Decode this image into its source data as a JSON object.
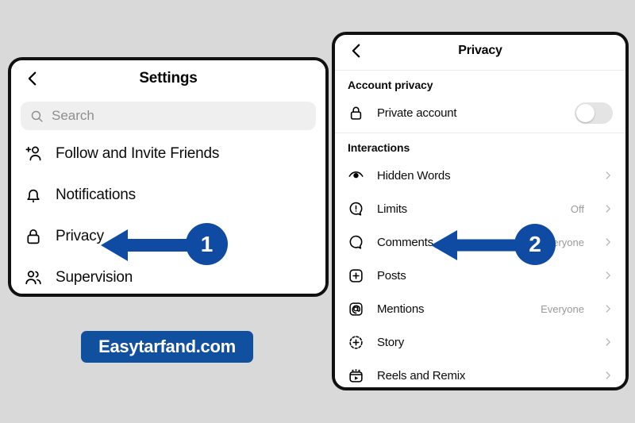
{
  "background_color": "#d9d9d9",
  "accent_color": "#0f4ba3",
  "watermark": {
    "text": "Easytarfand.com",
    "background": "#11509f",
    "text_color": "#ffffff"
  },
  "settings_panel": {
    "header": {
      "title": "Settings",
      "back_icon": "chevron-left-icon"
    },
    "search": {
      "placeholder": "Search",
      "value": "",
      "icon": "search-icon"
    },
    "items": [
      {
        "label": "Follow and Invite Friends",
        "icon": "add-person-icon"
      },
      {
        "label": "Notifications",
        "icon": "bell-icon"
      },
      {
        "label": "Privacy",
        "icon": "lock-icon"
      },
      {
        "label": "Supervision",
        "icon": "people-icon"
      }
    ]
  },
  "privacy_panel": {
    "header": {
      "title": "Privacy",
      "back_icon": "chevron-left-icon"
    },
    "sections": [
      {
        "title": "Account privacy",
        "items": [
          {
            "label": "Private account",
            "icon": "lock-icon",
            "control": "toggle",
            "toggle_on": false,
            "value": "",
            "chevron": false
          }
        ]
      },
      {
        "title": "Interactions",
        "items": [
          {
            "label": "Hidden Words",
            "icon": "eye-icon",
            "control": "chevron",
            "value": "",
            "chevron": true
          },
          {
            "label": "Limits",
            "icon": "exclamation-bubble-icon",
            "control": "chevron",
            "value": "Off",
            "chevron": true
          },
          {
            "label": "Comments",
            "icon": "comment-bubble-icon",
            "control": "chevron",
            "value": "Everyone",
            "chevron": true
          },
          {
            "label": "Posts",
            "icon": "plus-square-icon",
            "control": "chevron",
            "value": "",
            "chevron": true
          },
          {
            "label": "Mentions",
            "icon": "at-square-icon",
            "control": "chevron",
            "value": "Everyone",
            "chevron": true
          },
          {
            "label": "Story",
            "icon": "story-plus-icon",
            "control": "chevron",
            "value": "",
            "chevron": true
          },
          {
            "label": "Reels and Remix",
            "icon": "reels-icon",
            "control": "chevron",
            "value": "",
            "chevron": true
          }
        ]
      }
    ]
  },
  "annotations": [
    {
      "number": "1",
      "points_at": "Privacy",
      "color": "#0f4ba3"
    },
    {
      "number": "2",
      "points_at": "Comments",
      "color": "#0f4ba3"
    }
  ]
}
